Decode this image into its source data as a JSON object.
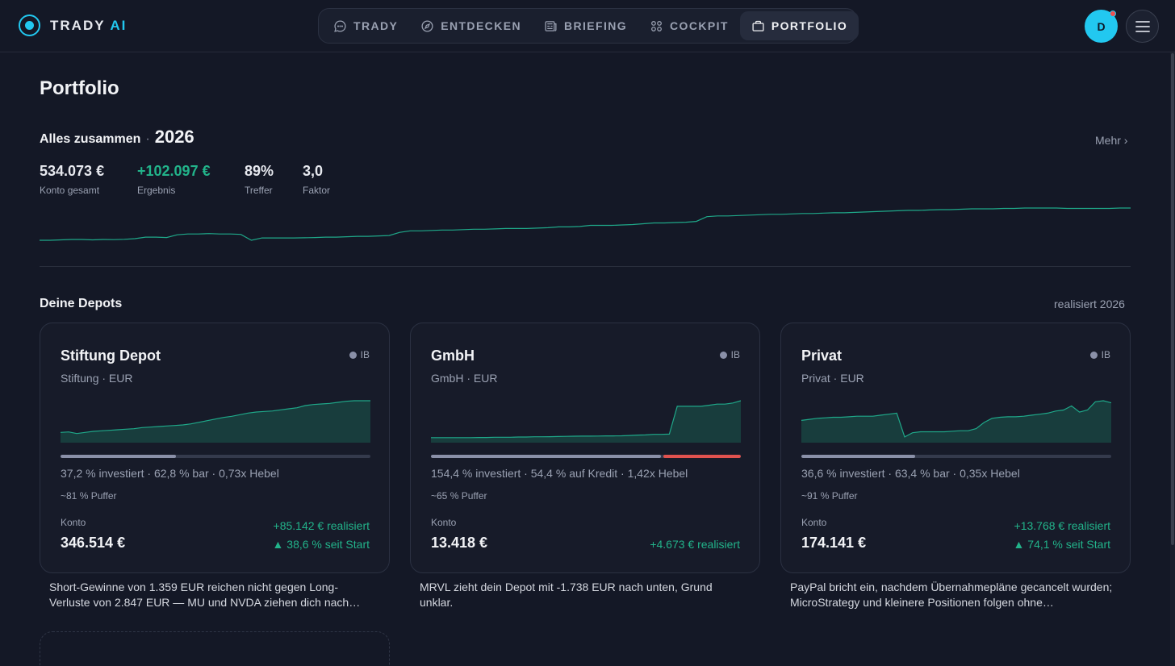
{
  "app": {
    "logo_main": "TRADY",
    "logo_accent": "AI"
  },
  "nav": [
    {
      "label": "TRADY",
      "icon": "chat-icon",
      "active": false
    },
    {
      "label": "ENTDECKEN",
      "icon": "compass-icon",
      "active": false
    },
    {
      "label": "BRIEFING",
      "icon": "newspaper-icon",
      "active": false
    },
    {
      "label": "COCKPIT",
      "icon": "grid-icon",
      "active": false
    },
    {
      "label": "PORTFOLIO",
      "icon": "briefcase-icon",
      "active": true
    }
  ],
  "user": {
    "initial": "D",
    "notification": true
  },
  "page": {
    "title": "Portfolio"
  },
  "summary": {
    "label": "Alles zusammen",
    "separator": "·",
    "year": "2026",
    "more": "Mehr ›",
    "stats": [
      {
        "value": "534.073 €",
        "label": "Konto gesamt",
        "positive": false
      },
      {
        "value": "+102.097 €",
        "label": "Ergebnis",
        "positive": true
      },
      {
        "value": "89%",
        "label": "Treffer",
        "positive": false
      },
      {
        "value": "3,0",
        "label": "Faktor",
        "positive": false
      }
    ],
    "line_color": "#1fa889",
    "series": [
      48,
      48,
      47.5,
      47,
      47,
      47.5,
      47,
      47.2,
      46.8,
      46,
      44,
      44,
      44.5,
      41,
      40,
      40,
      39.5,
      40,
      40,
      40.5,
      48,
      45,
      45,
      45,
      45,
      44.8,
      44.5,
      44,
      44,
      43.5,
      43,
      43,
      42.5,
      42,
      38,
      36,
      36,
      35.5,
      35,
      35,
      34.5,
      34,
      34,
      33.5,
      33,
      33,
      33,
      32.5,
      32,
      31,
      31,
      30.5,
      29,
      29,
      29,
      28.5,
      28,
      27,
      26,
      26,
      25.5,
      25,
      24,
      18,
      17,
      17,
      16.5,
      16,
      15.5,
      15,
      15,
      14.5,
      14,
      14,
      13.5,
      13,
      13,
      12.5,
      12,
      11.5,
      11,
      10.5,
      10,
      10,
      9.5,
      9,
      9,
      8.5,
      8,
      8,
      8,
      7.5,
      7.5,
      7,
      7,
      7,
      7,
      7.5,
      7.5,
      7.5,
      7.5,
      7.5,
      7,
      7
    ]
  },
  "depots": {
    "title": "Deine Depots",
    "label_right": "realisiert 2026",
    "cards": [
      {
        "name": "Stiftung Depot",
        "sub": "Stiftung · EUR",
        "broker": "IB",
        "invested_fraction": 0.372,
        "credit_fraction": 0,
        "info": "37,2 % investiert · 62,8 % bar · 0,73x Hebel",
        "puffer": "~81 % Puffer",
        "konto_label": "Konto",
        "konto_value": "346.514 €",
        "realized": "+85.142 € realisiert",
        "since_start": "▲ 38,6 % seit Start",
        "series": [
          8,
          8.5,
          7,
          8,
          9,
          9.5,
          10,
          10.5,
          11,
          11.5,
          12.5,
          13,
          13.5,
          14,
          14.5,
          15,
          16,
          17.5,
          19,
          20.5,
          22,
          23,
          24.5,
          26,
          27,
          27.5,
          28,
          29,
          30,
          31,
          33,
          34,
          34.5,
          35,
          36,
          37,
          37.5,
          37.5,
          37.5
        ]
      },
      {
        "name": "GmbH",
        "sub": "GmbH · EUR",
        "broker": "IB",
        "invested_fraction": 0.743,
        "credit_fraction": 0.257,
        "info": "154,4 % investiert · 54,4 % auf Kredit · 1,42x Hebel",
        "puffer": "~65 % Puffer",
        "konto_label": "Konto",
        "konto_value": "13.418 €",
        "realized": "+4.673 € realisiert",
        "since_start": "",
        "series": [
          3,
          3,
          3,
          3,
          3,
          3,
          3.2,
          3.2,
          3.4,
          3.4,
          3.4,
          3.6,
          3.6,
          3.8,
          3.8,
          3.9,
          4,
          4.2,
          4.3,
          4.4,
          4.4,
          4.5,
          4.6,
          4.6,
          4.7,
          5,
          5.3,
          5.5,
          6,
          6,
          6.2,
          31,
          31,
          31,
          31,
          32,
          33,
          33,
          34,
          36
        ]
      },
      {
        "name": "Privat",
        "sub": "Privat · EUR",
        "broker": "IB",
        "invested_fraction": 0.366,
        "credit_fraction": 0,
        "info": "36,6 % investiert · 63,4 % bar · 0,35x Hebel",
        "puffer": "~91 % Puffer",
        "konto_label": "Konto",
        "konto_value": "174.141 €",
        "realized": "+13.768 € realisiert",
        "since_start": "▲ 74,1 % seit Start",
        "series": [
          20,
          21,
          22,
          22.5,
          23,
          23,
          23.5,
          24,
          24,
          24,
          25,
          26,
          27,
          4,
          8,
          9,
          9,
          9,
          9,
          9.5,
          10,
          10,
          12,
          18,
          22,
          23,
          23.5,
          23.5,
          24,
          25,
          26,
          27,
          29,
          30,
          34,
          28,
          30,
          38,
          39,
          37
        ]
      }
    ]
  },
  "notes": [
    "Short-Gewinne von 1.359 EUR reichen nicht gegen Long-Verluste von 2.847 EUR — MU und NVDA ziehen dich nach…",
    "MRVL zieht dein Depot mit -1.738 EUR nach unten, Grund unklar.",
    "PayPal bricht ein, nachdem Übernahmepläne gecancelt wurden; MicroStrategy und kleinere Positionen folgen ohne…"
  ]
}
